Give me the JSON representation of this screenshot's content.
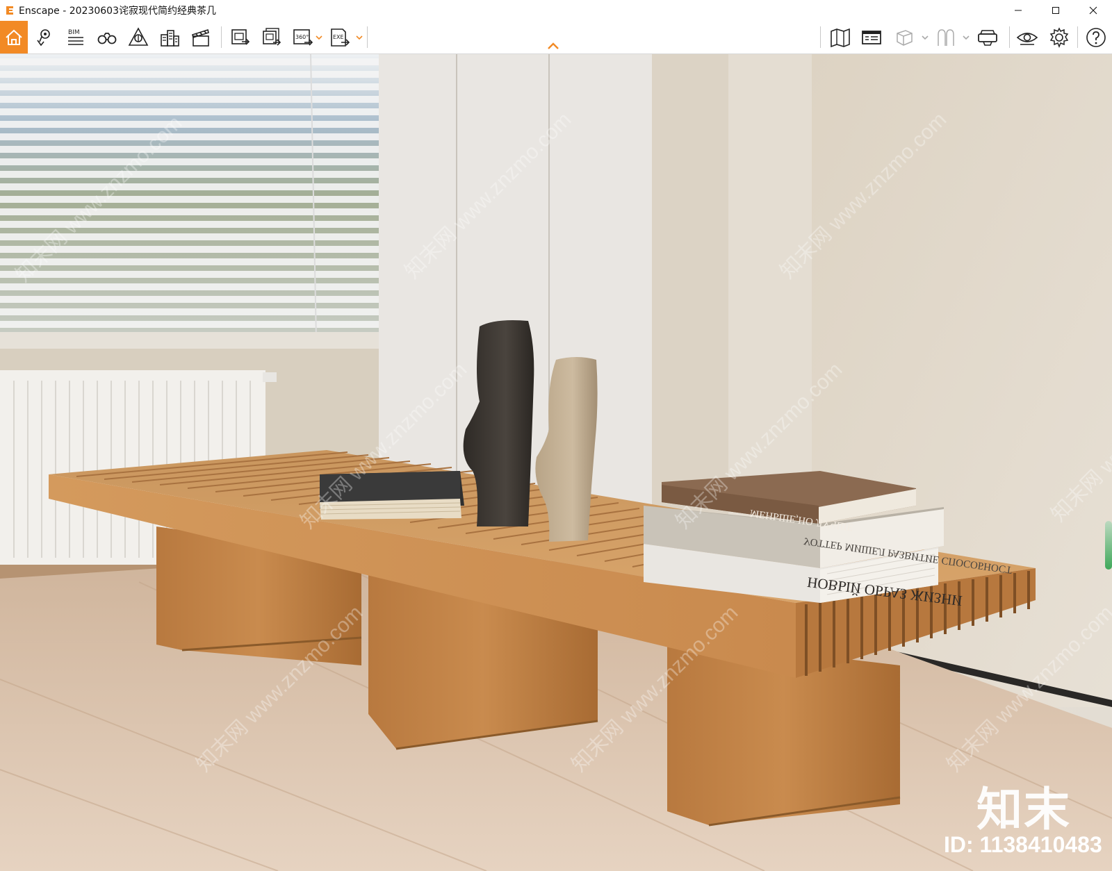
{
  "window": {
    "app_name": "Enscape",
    "title": "Enscape - 20230603诧寂现代简约经典茶几",
    "accent_color": "#f28a25",
    "controls": [
      "minimize-icon",
      "maximize-icon",
      "close-icon"
    ]
  },
  "toolbar": {
    "items": [
      {
        "name": "home",
        "icon": "home-icon"
      },
      {
        "name": "views",
        "icon": "location-pin-icon"
      },
      {
        "name": "bim",
        "icon": "bim-icon",
        "label": "BIM"
      },
      {
        "name": "walk-mode",
        "icon": "binoculars-icon"
      },
      {
        "name": "assets",
        "icon": "asset-library-icon"
      },
      {
        "name": "buildings",
        "icon": "buildings-icon"
      },
      {
        "name": "video",
        "icon": "clapperboard-icon"
      },
      {
        "name": "screenshot",
        "icon": "screenshot-export-icon"
      },
      {
        "name": "batch-render",
        "icon": "batch-render-icon"
      },
      {
        "name": "panorama",
        "icon": "panorama-360-icon",
        "label": "360°"
      },
      {
        "name": "exe-export",
        "icon": "exe-export-icon",
        "label": "EXE"
      },
      {
        "name": "map",
        "icon": "map-icon"
      },
      {
        "name": "presentation",
        "icon": "presentation-icon"
      },
      {
        "name": "cube",
        "icon": "cube-icon"
      },
      {
        "name": "collaboration",
        "icon": "people-icon"
      },
      {
        "name": "vr",
        "icon": "vr-headset-icon"
      },
      {
        "name": "visual-settings",
        "icon": "eye-icon"
      },
      {
        "name": "settings",
        "icon": "gear-icon"
      },
      {
        "name": "help",
        "icon": "help-icon"
      }
    ]
  },
  "viewport": {
    "watermark_logo": "知末",
    "watermark_id": "ID: 1138410483",
    "watermark_repeat": "知末网 www.znzmo.com",
    "books": {
      "top": "МЕНЬШЕ,НО ЛУЧШЕ",
      "middle": "УОТТЕР МИШЕЛ  РАЗВИТИЕ СПОСОБНОСТ",
      "bottom": "НОВЫЙ ОБРАЗ ЖИЗНИ"
    }
  }
}
